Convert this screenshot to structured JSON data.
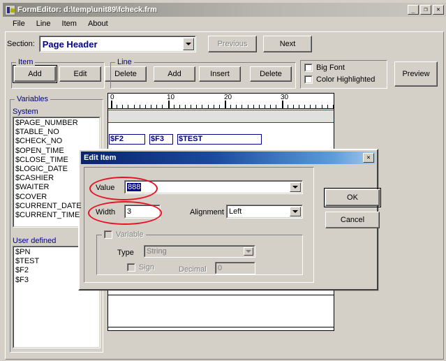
{
  "window": {
    "title": "FormEditor: d:\\temp\\unit89\\fcheck.frm",
    "icon": "form-editor-icon",
    "controls": {
      "minimize": "_",
      "maximize": "❐",
      "close": "✕"
    }
  },
  "menu": {
    "items": [
      "File",
      "Line",
      "Item",
      "About"
    ]
  },
  "toolbar": {
    "section_label": "Section:",
    "section_value": "Page Header",
    "previous_label": "Previous",
    "next_label": "Next",
    "preview_label": "Preview",
    "item_group_label": "Item",
    "item_buttons": [
      "Add",
      "Edit",
      "Delete"
    ],
    "line_group_label": "Line",
    "line_buttons": [
      "Add",
      "Insert",
      "Delete"
    ],
    "checkboxes": [
      {
        "label": "Big Font",
        "checked": false
      },
      {
        "label": "Color Highlighted",
        "checked": false
      }
    ]
  },
  "sidebar": {
    "group_label": "Variables",
    "system_label": "System",
    "system_items": [
      "$PAGE_NUMBER",
      "$TABLE_NO",
      "$CHECK_NO",
      "$OPEN_TIME",
      "$CLOSE_TIME",
      "$LOGIC_DATE",
      "$CASHIER",
      "$WAITER",
      "$COVER",
      "$CURRENT_DATE",
      "$CURRENT_TIME"
    ],
    "user_label": "User defined",
    "user_items": [
      "$PN",
      "$TEST",
      "$F2",
      "$F3"
    ]
  },
  "canvas": {
    "ruler_labels": [
      "0",
      "10",
      "20",
      "30"
    ],
    "fields": [
      "$F2",
      "$F3",
      "$TEST"
    ]
  },
  "dialog": {
    "title": "Edit Item",
    "close_label": "✕",
    "value_label": "Value",
    "value_text": "888",
    "width_label": "Width",
    "width_text": "3",
    "alignment_label": "Alignment",
    "alignment_value": "Left",
    "variable_group_label": "Variable",
    "variable_checked": false,
    "type_label": "Type",
    "type_value": "String",
    "sign_label": "Sign",
    "sign_checked": false,
    "decimal_label": "Decimal",
    "decimal_value": "0",
    "ok_label": "OK",
    "cancel_label": "Cancel"
  },
  "colors": {
    "face": "#d4d0c8",
    "dialog_title_start": "#0a246a",
    "dialog_title_end": "#a6c8ec",
    "group_label": "#00008b",
    "annotation": "#e81123",
    "selection": "#000080"
  }
}
